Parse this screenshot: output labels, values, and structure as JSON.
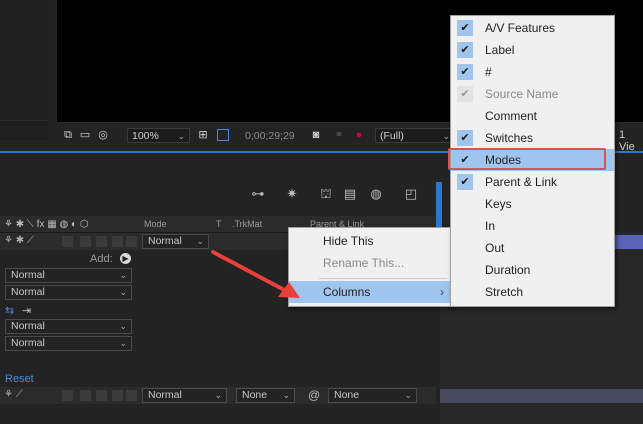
{
  "viewer": {
    "zoom": "100%",
    "timecode": "0;00;29;29",
    "resolution": "(Full)",
    "view_label": "1 Vie"
  },
  "timeline": {
    "headers": {
      "mode": "Mode",
      "t": "T",
      "trkmat": ".TrkMat",
      "parent": "Parent & Link"
    },
    "row1_mode": "Normal",
    "add_label": "Add:",
    "blend_modes": [
      "Normal",
      "Normal",
      "Normal",
      "Normal"
    ],
    "reset_label": "Reset",
    "bottom_row": {
      "mode": "Normal",
      "trkmat": "None",
      "parent": "None"
    }
  },
  "context_menu": {
    "items": [
      "Hide This",
      "Rename This...",
      "Columns"
    ],
    "submenu_arrow": "›"
  },
  "columns_submenu": {
    "items": [
      {
        "label": "A/V Features",
        "checked": true
      },
      {
        "label": "Label",
        "checked": true
      },
      {
        "label": "#",
        "checked": true
      },
      {
        "label": "Source Name",
        "checked": "disabled"
      },
      {
        "label": "Comment",
        "checked": false
      },
      {
        "label": "Switches",
        "checked": true
      },
      {
        "label": "Modes",
        "checked": true
      },
      {
        "label": "Parent & Link",
        "checked": true
      },
      {
        "label": "Keys",
        "checked": false
      },
      {
        "label": "In",
        "checked": false
      },
      {
        "label": "Out",
        "checked": false
      },
      {
        "label": "Duration",
        "checked": false
      },
      {
        "label": "Stretch",
        "checked": false
      }
    ]
  },
  "colors": {
    "accent_blue": "#2d78c8",
    "highlight_red": "#d9534f",
    "arrow_red": "#e8413c",
    "menu_hover": "#9fc4ee"
  }
}
